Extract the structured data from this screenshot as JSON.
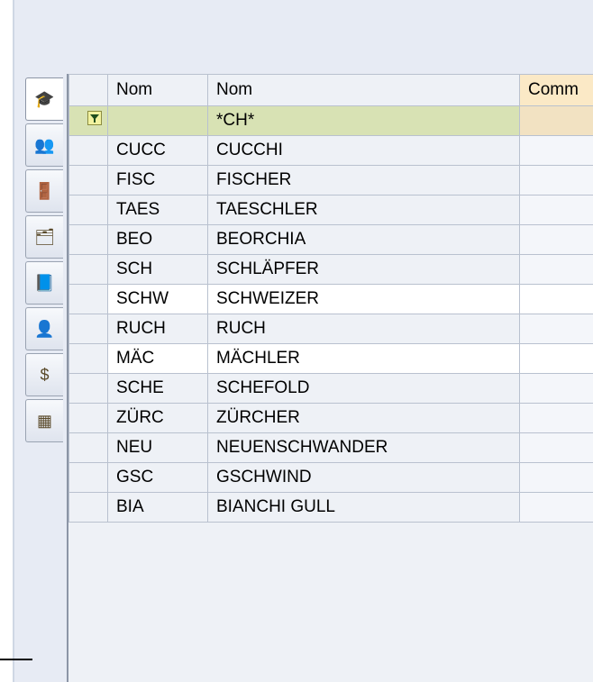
{
  "sidebar": {
    "tabs": [
      {
        "icon": "graduation-cap-icon",
        "glyph": "🎓",
        "active": true
      },
      {
        "icon": "users-icon",
        "glyph": "👥",
        "active": false
      },
      {
        "icon": "door-icon",
        "glyph": "🚪",
        "active": false
      },
      {
        "icon": "rooms-icon",
        "glyph": "🗂",
        "active": false
      },
      {
        "icon": "book-icon",
        "glyph": "📘",
        "active": false
      },
      {
        "icon": "person-icon",
        "glyph": "👤",
        "active": false
      },
      {
        "icon": "dollar-icon",
        "glyph": "$",
        "active": false
      },
      {
        "icon": "table-icon",
        "glyph": "▦",
        "active": false
      }
    ]
  },
  "grid": {
    "headers": {
      "col1": "Nom",
      "col2": "Nom",
      "col3": "Comm"
    },
    "filter": {
      "col1": "",
      "col2": "*CH*",
      "col3": ""
    },
    "rows": [
      {
        "short": "CUCC",
        "name": "CUCCHI",
        "comment": "",
        "highlight": false
      },
      {
        "short": "FISC",
        "name": "FISCHER",
        "comment": "",
        "highlight": false
      },
      {
        "short": "TAES",
        "name": "TAESCHLER",
        "comment": "",
        "highlight": false
      },
      {
        "short": "BEO",
        "name": "BEORCHIA",
        "comment": "",
        "highlight": false
      },
      {
        "short": "SCH",
        "name": "SCHLÄPFER",
        "comment": "",
        "highlight": false
      },
      {
        "short": "SCHW",
        "name": "SCHWEIZER",
        "comment": "",
        "highlight": true
      },
      {
        "short": "RUCH",
        "name": "RUCH",
        "comment": "",
        "highlight": false
      },
      {
        "short": "MÄC",
        "name": "MÄCHLER",
        "comment": "",
        "highlight": true
      },
      {
        "short": "SCHE",
        "name": "SCHEFOLD",
        "comment": "",
        "highlight": false
      },
      {
        "short": "ZÜRC",
        "name": "ZÜRCHER",
        "comment": "",
        "highlight": false
      },
      {
        "short": "NEU",
        "name": "NEUENSCHWANDER",
        "comment": "",
        "highlight": false
      },
      {
        "short": "GSC",
        "name": "GSCHWIND",
        "comment": "",
        "highlight": false
      },
      {
        "short": "BIA",
        "name": "BIANCHI GULL",
        "comment": "",
        "highlight": false
      }
    ]
  },
  "colors": {
    "filter_row": "#d8e2b4",
    "comment_header": "#fbe9c6",
    "panel": "#e7ebf4"
  }
}
